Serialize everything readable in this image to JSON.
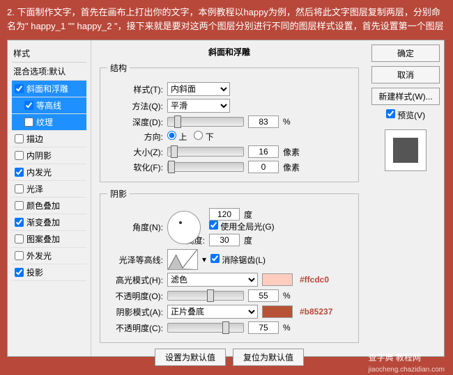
{
  "instruction": "2. 下面制作文字，首先在画布上打出你的文字，本例教程以happy为例，然后将此文字图层复制两层，分别命名为\" happy_1 \"\" happy_2 \"，接下来就是要对这两个图层分别进行不同的图层样式设置，首先设置第一个图层",
  "left": {
    "title": "样式",
    "blend": "混合选项:默认",
    "items": [
      {
        "label": "斜面和浮雕",
        "checked": true,
        "sel": true,
        "indent": false
      },
      {
        "label": "等高线",
        "checked": true,
        "sel": true,
        "indent": true
      },
      {
        "label": "纹理",
        "checked": false,
        "sel": true,
        "indent": true
      },
      {
        "label": "描边",
        "checked": false,
        "sel": false,
        "indent": false
      },
      {
        "label": "内阴影",
        "checked": false,
        "sel": false,
        "indent": false
      },
      {
        "label": "内发光",
        "checked": true,
        "sel": false,
        "indent": false
      },
      {
        "label": "光泽",
        "checked": false,
        "sel": false,
        "indent": false
      },
      {
        "label": "颜色叠加",
        "checked": false,
        "sel": false,
        "indent": false
      },
      {
        "label": "渐变叠加",
        "checked": true,
        "sel": false,
        "indent": false
      },
      {
        "label": "图案叠加",
        "checked": false,
        "sel": false,
        "indent": false
      },
      {
        "label": "外发光",
        "checked": false,
        "sel": false,
        "indent": false
      },
      {
        "label": "投影",
        "checked": true,
        "sel": false,
        "indent": false
      }
    ]
  },
  "main": {
    "heading": "斜面和浮雕",
    "structure_legend": "结构",
    "style_label": "样式(T):",
    "style_value": "内斜面",
    "method_label": "方法(Q):",
    "method_value": "平滑",
    "depth_label": "深度(D):",
    "depth_value": "83",
    "percent": "%",
    "direction_label": "方向:",
    "dir_up": "上",
    "dir_down": "下",
    "size_label": "大小(Z):",
    "size_value": "16",
    "px": "像素",
    "soften_label": "软化(F):",
    "soften_value": "0",
    "shading_legend": "阴影",
    "angle_label": "角度(N):",
    "angle_value": "120",
    "degree": "度",
    "global_light": "使用全局光(G)",
    "altitude_label": "高度:",
    "altitude_value": "30",
    "gloss_label": "光泽等高线:",
    "antialias": "消除锯齿(L)",
    "highlight_mode_label": "高光模式(H):",
    "highlight_mode_value": "滤色",
    "highlight_color": "#ffcdc0",
    "highlight_opacity_label": "不透明度(O):",
    "highlight_opacity_value": "55",
    "shadow_mode_label": "阴影模式(A):",
    "shadow_mode_value": "正片叠底",
    "shadow_color": "#b85237",
    "shadow_opacity_label": "不透明度(C):",
    "shadow_opacity_value": "75",
    "make_default": "设置为默认值",
    "reset_default": "复位为默认值"
  },
  "right": {
    "ok": "确定",
    "cancel": "取消",
    "new_style": "新建样式(W)...",
    "preview": "预览(V)"
  },
  "watermark": {
    "main": "查字典 教程网",
    "sub": "jiaocheng.chazidian.com"
  }
}
